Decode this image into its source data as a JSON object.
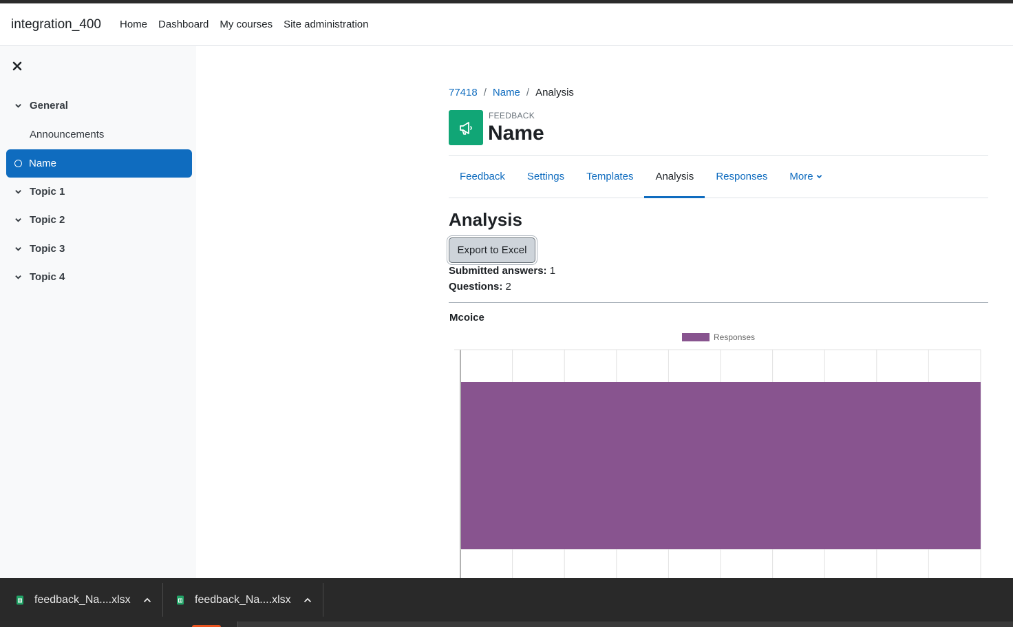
{
  "navbar": {
    "brand": "integration_400",
    "links": [
      "Home",
      "Dashboard",
      "My courses",
      "Site administration"
    ]
  },
  "drawer": {
    "close_icon": "close-icon",
    "items": [
      {
        "label": "General",
        "kind": "section",
        "expanded": true
      },
      {
        "label": "Announcements",
        "kind": "activity"
      },
      {
        "label": "Name",
        "kind": "activity",
        "active": true
      },
      {
        "label": "Topic 1",
        "kind": "section",
        "expanded": true
      },
      {
        "label": "Topic 2",
        "kind": "section",
        "expanded": true
      },
      {
        "label": "Topic 3",
        "kind": "section",
        "expanded": true
      },
      {
        "label": "Topic 4",
        "kind": "section",
        "expanded": true
      }
    ]
  },
  "breadcrumb": [
    "77418",
    "Name",
    "Analysis"
  ],
  "module": {
    "type_label": "FEEDBACK",
    "title": "Name",
    "icon": "megaphone-icon",
    "icon_color": "#11a676"
  },
  "tabs": [
    {
      "label": "Feedback",
      "active": false
    },
    {
      "label": "Settings",
      "active": false
    },
    {
      "label": "Templates",
      "active": false
    },
    {
      "label": "Analysis",
      "active": true
    },
    {
      "label": "Responses",
      "active": false
    },
    {
      "label": "More",
      "active": false,
      "dropdown": true
    }
  ],
  "analysis": {
    "heading": "Analysis",
    "export_button": "Export to Excel",
    "submitted_label": "Submitted answers:",
    "submitted_value": "1",
    "questions_label": "Questions:",
    "questions_value": "2"
  },
  "question": {
    "title": "Mcoice"
  },
  "chart_data": {
    "type": "bar",
    "orientation": "horizontal",
    "legend_position": "top",
    "series": [
      {
        "name": "Responses",
        "color": "#88548f",
        "values": [
          1
        ]
      }
    ],
    "grid": true
  },
  "downloads": [
    {
      "filename": "feedback_Na....xlsx",
      "icon": "spreadsheet-file-icon"
    },
    {
      "filename": "feedback_Na....xlsx",
      "icon": "spreadsheet-file-icon"
    }
  ],
  "colors": {
    "primary": "#0f6cbf",
    "chart_bar": "#88548f",
    "feedback_icon": "#11a676"
  }
}
